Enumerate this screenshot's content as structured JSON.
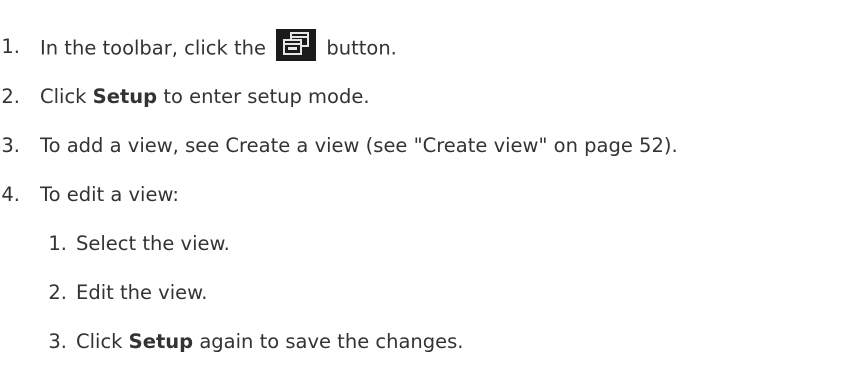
{
  "steps": [
    {
      "number": "1.",
      "before": "In the toolbar, click the",
      "icon": "window-setup-icon",
      "after": "button."
    },
    {
      "number": "2.",
      "before": "Click",
      "bold": "Setup",
      "after": "to enter setup mode."
    },
    {
      "number": "3.",
      "text": "To add a view, see Create a view (see \"Create view\" on page 52)."
    },
    {
      "number": "4.",
      "text": "To edit a view:",
      "substeps": [
        {
          "number": "1.",
          "text": "Select the view."
        },
        {
          "number": "2.",
          "text": "Edit the view."
        },
        {
          "number": "3.",
          "before": "Click",
          "bold": "Setup",
          "after": "again to save the changes."
        }
      ]
    }
  ],
  "colors": {
    "text": "#333333",
    "button_background": "#1b1b1b",
    "button_icon": "#e6e6e6"
  }
}
